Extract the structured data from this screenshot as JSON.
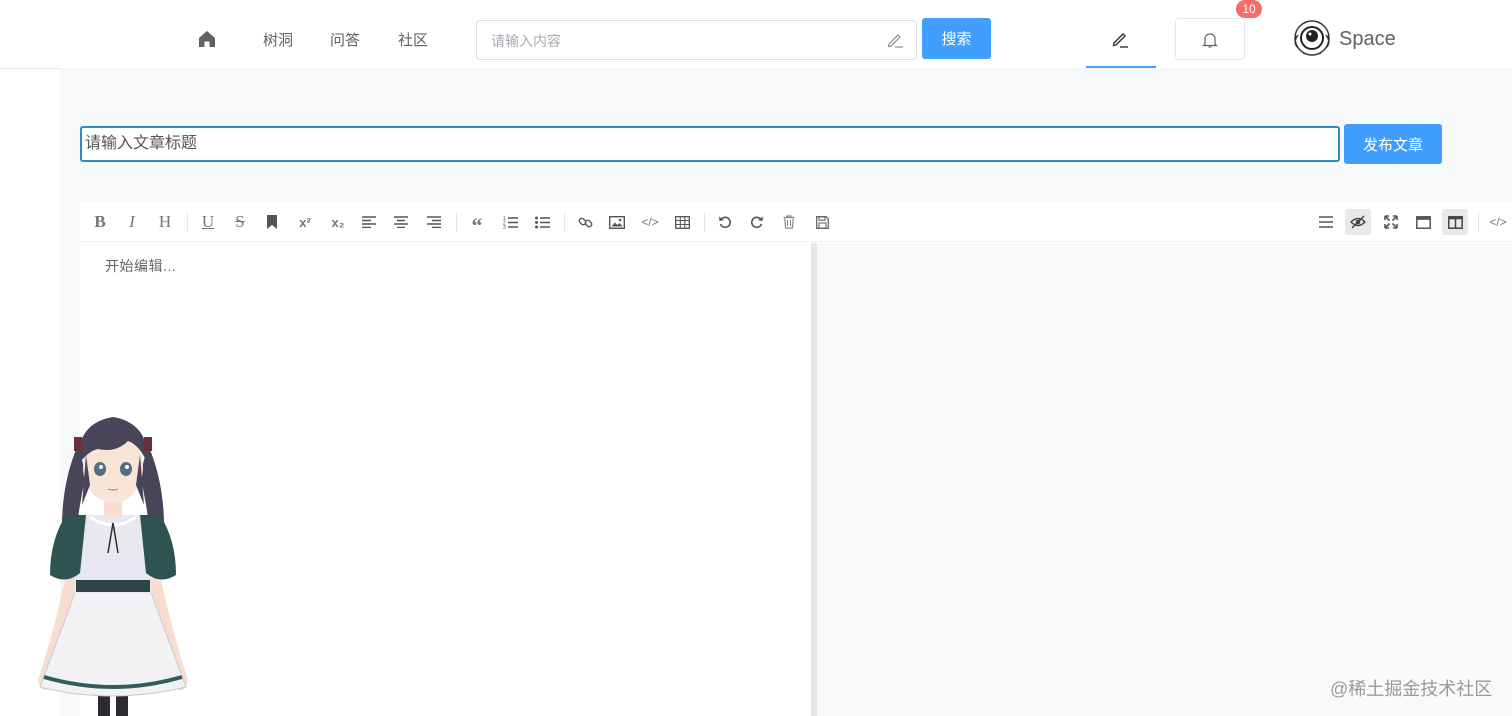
{
  "nav": {
    "home_icon": "home-icon",
    "links": [
      "树洞",
      "问答",
      "社区"
    ]
  },
  "search": {
    "placeholder": "请输入内容",
    "value": "",
    "icon": "pen-icon",
    "button_label": "搜索"
  },
  "header": {
    "write_icon": "pen-icon",
    "bell_icon": "bell-icon",
    "notification_count": "10",
    "user_name": "Space"
  },
  "editor": {
    "title_placeholder": "请输入文章标题",
    "publish_label": "发布文章",
    "content_placeholder": "开始编辑...",
    "toolbar_left": [
      "bold",
      "italic",
      "header",
      "underline",
      "strikethrough",
      "mark",
      "superscript",
      "subscript",
      "align-left",
      "align-center",
      "align-right",
      "quote",
      "ordered-list",
      "unordered-list",
      "link",
      "image",
      "code",
      "table",
      "undo",
      "redo",
      "trash",
      "save"
    ],
    "toolbar_right": [
      "navigation",
      "preview-toggle",
      "fullscreen",
      "read-mode",
      "subfield",
      "html-code"
    ]
  },
  "watermark": "@稀土掘金技术社区",
  "colors": {
    "primary": "#409eff",
    "badge": "#f56c6c",
    "title_border": "#2a8fbd",
    "page_bg": "#f7f8fa"
  }
}
